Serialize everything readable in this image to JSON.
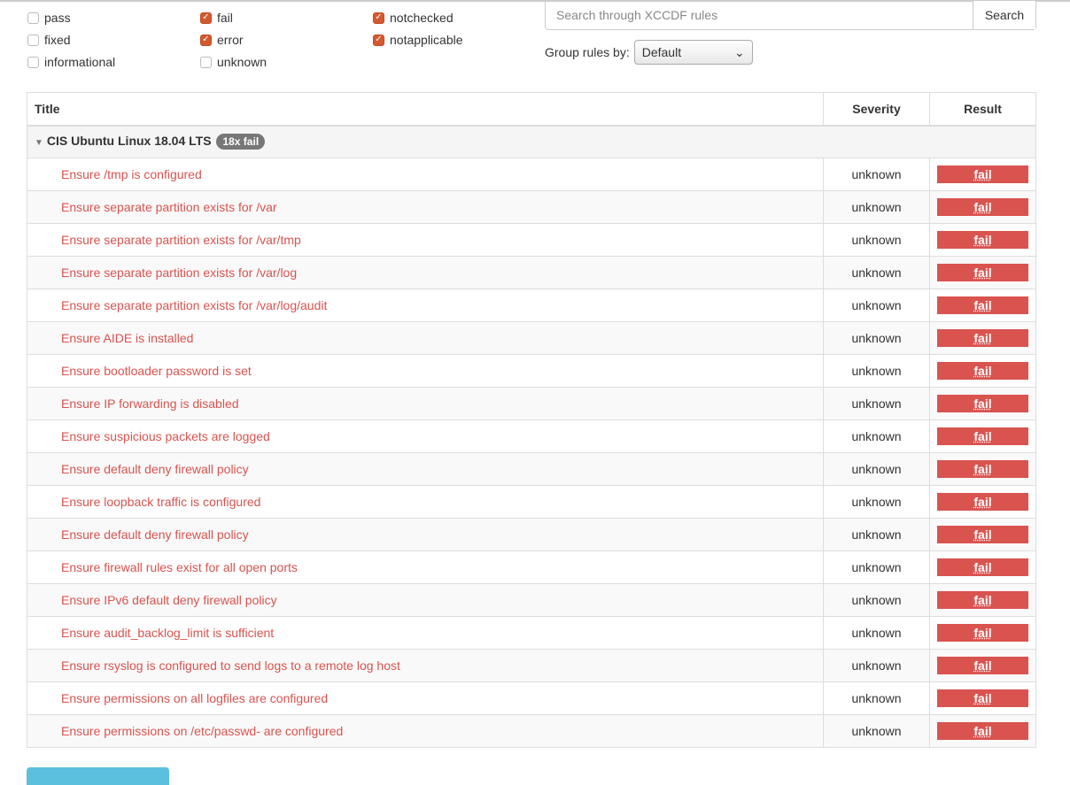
{
  "filters": [
    {
      "label": "pass",
      "checked": false
    },
    {
      "label": "fixed",
      "checked": false
    },
    {
      "label": "informational",
      "checked": false
    },
    {
      "label": "fail",
      "checked": true
    },
    {
      "label": "error",
      "checked": true
    },
    {
      "label": "unknown",
      "checked": false
    },
    {
      "label": "notchecked",
      "checked": true
    },
    {
      "label": "notapplicable",
      "checked": true
    }
  ],
  "search": {
    "placeholder": "Search through XCCDF rules",
    "button": "Search"
  },
  "group_by": {
    "label": "Group rules by:",
    "value": "Default"
  },
  "table": {
    "headers": {
      "title": "Title",
      "severity": "Severity",
      "result": "Result"
    },
    "group": {
      "name": "CIS Ubuntu Linux 18.04 LTS",
      "badge": "18x fail"
    },
    "rows": [
      {
        "title": "Ensure /tmp is configured",
        "severity": "unknown",
        "result": "fail"
      },
      {
        "title": "Ensure separate partition exists for /var",
        "severity": "unknown",
        "result": "fail"
      },
      {
        "title": "Ensure separate partition exists for /var/tmp",
        "severity": "unknown",
        "result": "fail"
      },
      {
        "title": "Ensure separate partition exists for /var/log",
        "severity": "unknown",
        "result": "fail"
      },
      {
        "title": "Ensure separate partition exists for /var/log/audit",
        "severity": "unknown",
        "result": "fail"
      },
      {
        "title": "Ensure AIDE is installed",
        "severity": "unknown",
        "result": "fail"
      },
      {
        "title": "Ensure bootloader password is set",
        "severity": "unknown",
        "result": "fail"
      },
      {
        "title": "Ensure IP forwarding is disabled",
        "severity": "unknown",
        "result": "fail"
      },
      {
        "title": "Ensure suspicious packets are logged",
        "severity": "unknown",
        "result": "fail"
      },
      {
        "title": "Ensure default deny firewall policy",
        "severity": "unknown",
        "result": "fail"
      },
      {
        "title": "Ensure loopback traffic is configured",
        "severity": "unknown",
        "result": "fail"
      },
      {
        "title": "Ensure default deny firewall policy",
        "severity": "unknown",
        "result": "fail"
      },
      {
        "title": "Ensure firewall rules exist for all open ports",
        "severity": "unknown",
        "result": "fail"
      },
      {
        "title": "Ensure IPv6 default deny firewall policy",
        "severity": "unknown",
        "result": "fail"
      },
      {
        "title": "Ensure audit_backlog_limit is sufficient",
        "severity": "unknown",
        "result": "fail"
      },
      {
        "title": "Ensure rsyslog is configured to send logs to a remote log host",
        "severity": "unknown",
        "result": "fail"
      },
      {
        "title": "Ensure permissions on all logfiles are configured",
        "severity": "unknown",
        "result": "fail"
      },
      {
        "title": "Ensure permissions on /etc/passwd- are configured",
        "severity": "unknown",
        "result": "fail"
      }
    ]
  }
}
